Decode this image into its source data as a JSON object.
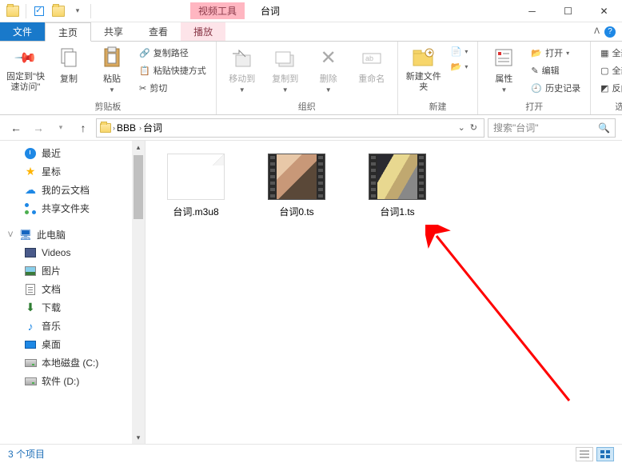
{
  "title": "台词",
  "context_tab": "视频工具",
  "tabs": {
    "file": "文件",
    "home": "主页",
    "share": "共享",
    "view": "查看",
    "play": "播放"
  },
  "ribbon": {
    "pin": "固定到\"快速访问\"",
    "copy": "复制",
    "paste": "粘贴",
    "copy_path": "复制路径",
    "paste_shortcut": "粘贴快捷方式",
    "cut": "剪切",
    "group_clipboard": "剪贴板",
    "move_to": "移动到",
    "copy_to": "复制到",
    "delete": "删除",
    "rename": "重命名",
    "group_organize": "组织",
    "new_folder": "新建文件夹",
    "group_new": "新建",
    "properties": "属性",
    "open": "打开",
    "edit": "编辑",
    "history": "历史记录",
    "group_open": "打开",
    "select_all": "全部选择",
    "select_none": "全部取消",
    "invert_sel": "反向选择",
    "group_select": "选择"
  },
  "breadcrumb": {
    "root_chev": "›",
    "seg1": "BBB",
    "seg2": "台词"
  },
  "search_placeholder": "搜索\"台词\"",
  "sidebar": {
    "recent": "最近",
    "star": "星标",
    "cloud": "我的云文档",
    "shared": "共享文件夹",
    "pc": "此电脑",
    "videos": "Videos",
    "pictures": "图片",
    "documents": "文档",
    "downloads": "下载",
    "music": "音乐",
    "desktop": "桌面",
    "drive_c": "本地磁盘 (C:)",
    "drive_d": "软件 (D:)"
  },
  "files": [
    {
      "name": "台词.m3u8",
      "type": "doc"
    },
    {
      "name": "台词0.ts",
      "type": "video1"
    },
    {
      "name": "台词1.ts",
      "type": "video2"
    }
  ],
  "status": "3 个项目"
}
